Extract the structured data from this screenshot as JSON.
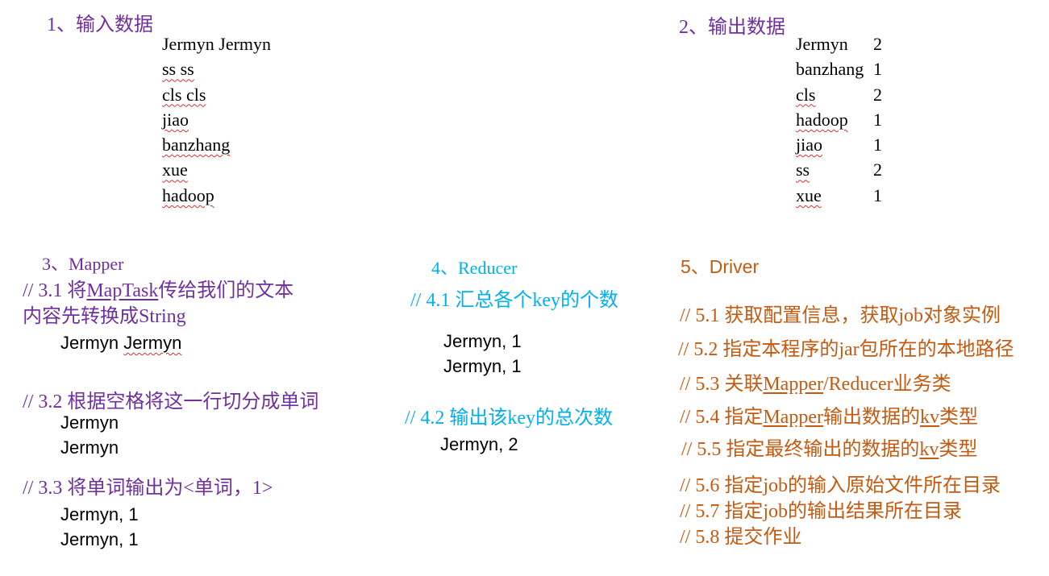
{
  "input_section": {
    "title": "1、输入数据",
    "lines": [
      "Jermyn Jermyn",
      "ss ss",
      "cls cls",
      "jiao",
      "banzhang",
      "xue",
      "hadoop"
    ]
  },
  "output_section": {
    "title": "2、输出数据",
    "rows": [
      {
        "word": "Jermyn",
        "count": "2"
      },
      {
        "word": "banzhang",
        "count": "1"
      },
      {
        "word": "cls",
        "count": "2"
      },
      {
        "word": "hadoop",
        "count": "1"
      },
      {
        "word": "jiao",
        "count": "1"
      },
      {
        "word": "ss",
        "count": "2"
      },
      {
        "word": "xue",
        "count": "1"
      }
    ]
  },
  "mapper": {
    "title": "3、Mapper",
    "step1": {
      "prefix": "//  3.1  将",
      "link": "MapTask",
      "rest": "传给我们的文本",
      "line2": "内容先转换成String"
    },
    "step1_example": {
      "first": "Jermyn ",
      "second": "Jermyn"
    },
    "step2": "// 3.2 根据空格将这一行切分成单词",
    "step2_lines": [
      "Jermyn",
      "Jermyn"
    ],
    "step3": "// 3.3 将单词输出为<单词，1>",
    "step3_lines": [
      "Jermyn, 1",
      "Jermyn, 1"
    ]
  },
  "reducer": {
    "title": "4、Reducer",
    "step1": "// 4.1 汇总各个key的个数",
    "step1_lines": [
      "Jermyn, 1",
      "Jermyn, 1"
    ],
    "step2": "// 4.2  输出该key的总次数",
    "step2_lines": [
      "Jermyn, 2"
    ]
  },
  "driver": {
    "title": "5、Driver",
    "s1": "// 5.1 获取配置信息，获取job对象实例",
    "s2": "// 5.2 指定本程序的jar包所在的本地路径",
    "s3": {
      "a": "// 5.3 关联",
      "u": "Mapper",
      "b": "/Reducer业务类"
    },
    "s4": {
      "a": "// 5.4 指定",
      "u1": "Mapper",
      "b": "输出数据的",
      "u2": "kv",
      "c": "类型"
    },
    "s5": {
      "a": "// 5.5 指定最终输出的数据的",
      "u": "kv",
      "b": "类型"
    },
    "s6": "// 5.6 指定job的输入原始文件所在目录",
    "s7": "// 5.7  指定job的输出结果所在目录",
    "s8": "// 5.8 提交作业"
  }
}
